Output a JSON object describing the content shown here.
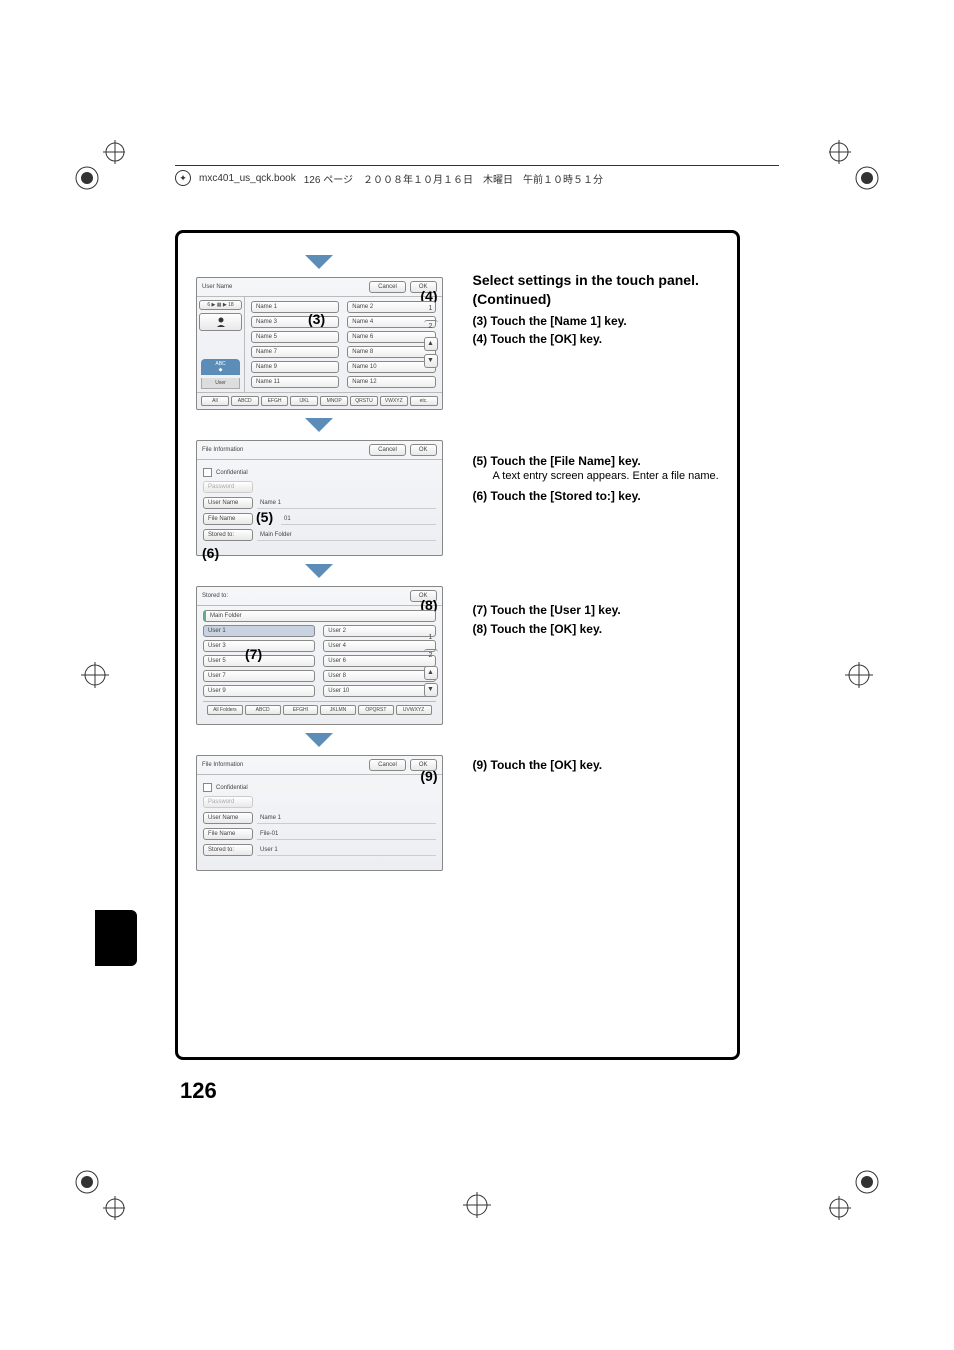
{
  "header": {
    "filename": "mxc401_us_qck.book",
    "page_info": "126 ページ　２００８年１０月１６日　木曜日　午前１０時５１分"
  },
  "page_number": "126",
  "instructions": {
    "title": "Select settings in the touch panel. (Continued)",
    "step3": "(3) Touch the [Name 1] key.",
    "step4": "(4) Touch the [OK] key.",
    "step5": "(5) Touch the [File Name] key.",
    "step5_note": "A text entry screen appears. Enter a file name.",
    "step6": "(6) Touch the [Stored to:] key.",
    "step7": "(7) Touch the [User 1] key.",
    "step8": "(8) Touch the [OK] key.",
    "step9": "(9) Touch the [OK] key."
  },
  "callouts": {
    "c3": "(3)",
    "c4": "(4)",
    "c5": "(5)",
    "c6": "(6)",
    "c7": "(7)",
    "c8": "(8)",
    "c9": "(9)"
  },
  "panel1": {
    "title": "User Name",
    "cancel": "Cancel",
    "ok": "OK",
    "page_indicator": "6 ▶ ▦ ▶ 18",
    "abc": "ABC",
    "user": "User",
    "names": [
      "Name 1",
      "Name 2",
      "Name 3",
      "Name 4",
      "Name 5",
      "Name 6",
      "Name 7",
      "Name 8",
      "Name 9",
      "Name 10",
      "Name 11",
      "Name 12"
    ],
    "counter": [
      "1",
      "2"
    ],
    "tabs": [
      "All",
      "ABCD",
      "EFGH",
      "IJKL",
      "MNOP",
      "QRSTU",
      "VWXYZ",
      "etc."
    ]
  },
  "panel2": {
    "title": "File Information",
    "cancel": "Cancel",
    "ok": "OK",
    "confidential": "Confidential",
    "password": "Password",
    "username_btn": "User Name",
    "username_val": "Name 1",
    "filename_btn": "File Name",
    "filename_val": "01",
    "storedto_btn": "Stored to:",
    "storedto_val": "Main Folder"
  },
  "panel3": {
    "title": "Stored to:",
    "ok": "OK",
    "main_folder": "Main Folder",
    "users": [
      "User 1",
      "User 2",
      "User 3",
      "User 4",
      "User 5",
      "User 6",
      "User 7",
      "User 8",
      "User 9",
      "User 10"
    ],
    "counter": [
      "1",
      "2"
    ],
    "tabs": [
      "All Folders",
      "ABCD",
      "EFGHI",
      "JKLMN",
      "OPQRST",
      "UVWXYZ"
    ]
  },
  "panel4": {
    "title": "File Information",
    "cancel": "Cancel",
    "ok": "OK",
    "confidential": "Confidential",
    "password": "Password",
    "username_btn": "User Name",
    "username_val": "Name 1",
    "filename_btn": "File Name",
    "filename_val": "File-01",
    "storedto_btn": "Stored to:",
    "storedto_val": "User 1"
  }
}
